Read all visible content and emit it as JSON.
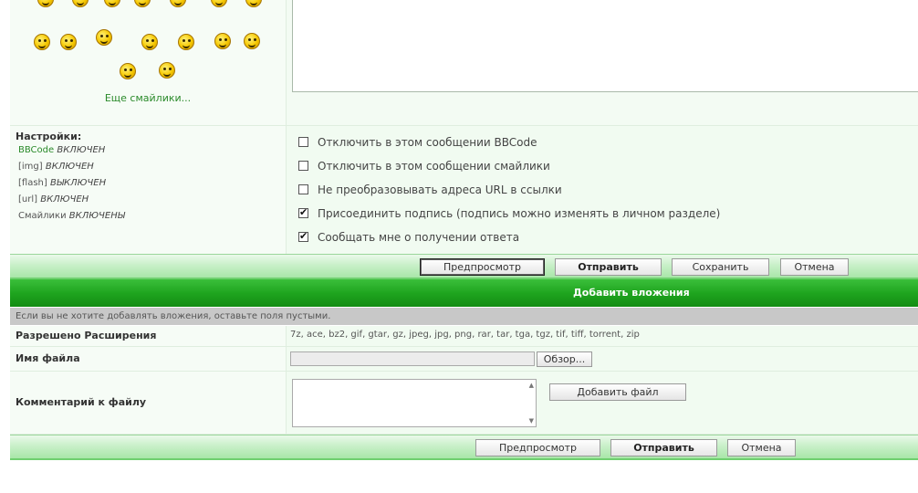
{
  "smilies": {
    "more_label": "Еще смайлики...",
    "icon": "smiley-face-icon"
  },
  "settings": {
    "title": "Настройки:",
    "items": [
      {
        "key": "BBCode",
        "value": "ВКЛЮЧЕН"
      },
      {
        "key": "[img]",
        "value": "ВКЛЮЧЕН"
      },
      {
        "key": "[flash]",
        "value": "ВЫКЛЮЧЕН"
      },
      {
        "key": "[url]",
        "value": "ВКЛЮЧЕН"
      },
      {
        "key": "Смайлики",
        "value": "ВКЛЮЧЕНЫ"
      }
    ],
    "options": [
      {
        "label": "Отключить в этом сообщении BBCode",
        "checked": false
      },
      {
        "label": "Отключить в этом сообщении смайлики",
        "checked": false
      },
      {
        "label": "Не преобразовывать адреса URL в ссылки",
        "checked": false
      },
      {
        "label": "Присоединить подпись (подпись можно изменять в личном разделе)",
        "checked": true
      },
      {
        "label": "Сообщать мне о получении ответа",
        "checked": true
      }
    ]
  },
  "buttons_top": {
    "preview": "Предпросмотр",
    "submit": "Отправить",
    "save": "Сохранить",
    "cancel": "Отмена"
  },
  "attachments": {
    "header": "Добавить вложения",
    "note": "Если вы не хотите добавлять вложения, оставьте поля пустыми.",
    "allowed_label": "Разрешено Расширения",
    "allowed_value": "7z, ace, bz2, gif, gtar, gz, jpeg, jpg, png, rar, tar, tga, tgz, tif, tiff, torrent, zip",
    "filename_label": "Имя файла",
    "browse": "Обзор...",
    "comment_label": "Комментарий к файлу",
    "add_file": "Добавить файл"
  },
  "buttons_bottom": {
    "preview": "Предпросмотр",
    "submit": "Отправить",
    "cancel": "Отмена"
  }
}
